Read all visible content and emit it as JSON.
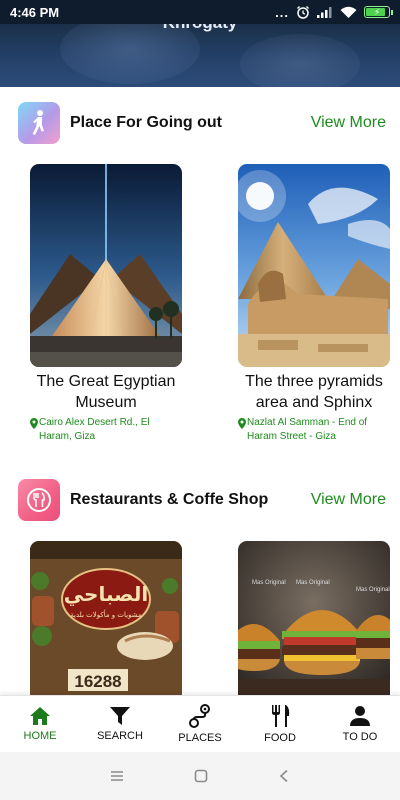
{
  "status_bar": {
    "time": "4:46 PM",
    "dots": "...",
    "icons": [
      "alarm-icon",
      "signal-icon",
      "wifi-icon",
      "battery-charging-icon"
    ],
    "battery_fraction": 0.9
  },
  "header": {
    "title": "Khrogaty"
  },
  "sections": [
    {
      "title": "Place For Going out",
      "view_more": "View More",
      "icon": "walking-person-icon",
      "cards": [
        {
          "name": "The Great Egyptian Museum",
          "location": "Cairo Alex Desert Rd., El Haram, Giza"
        },
        {
          "name": "The three pyramids area and Sphinx",
          "location": "Nazlat Al Samman - End of Haram Street - Giza"
        }
      ]
    },
    {
      "title": "Restaurants & Coffe Shop",
      "view_more": "View More",
      "icon": "cutlery-icon",
      "cards": [
        {
          "name": "",
          "location": "",
          "image_text": {
            "arabic": "الصباحي",
            "sub": "مشويات و مأكولات بلدية",
            "phone": "16288"
          }
        },
        {
          "name": "",
          "location": "",
          "image_text": {
            "brand": "Mas Original",
            "brand2": "Mas Original",
            "brand3": "Mas Original"
          }
        }
      ]
    }
  ],
  "nav": [
    {
      "label": "HOME",
      "icon": "home-icon",
      "active": true
    },
    {
      "label": "SEARCH",
      "icon": "filter-icon",
      "active": false
    },
    {
      "label": "PLACES",
      "icon": "route-icon",
      "active": false
    },
    {
      "label": "FOOD",
      "icon": "cutlery-icon",
      "active": false
    },
    {
      "label": "TO DO",
      "icon": "person-icon",
      "active": false
    }
  ],
  "colors": {
    "accent_green": "#1d8b1d",
    "status_bar": "#0e1c2d"
  }
}
